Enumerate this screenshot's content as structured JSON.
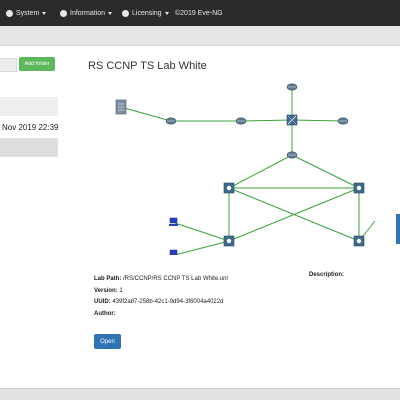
{
  "navbar": {
    "items": [
      {
        "label": "System",
        "icon": "menu-icon",
        "has_caret": true
      },
      {
        "label": "Information",
        "icon": "info-icon",
        "has_caret": true
      },
      {
        "label": "Licensing",
        "icon": "license-icon",
        "has_caret": true
      }
    ],
    "copyright": "©2019 Eve-NG"
  },
  "sidebar": {
    "add_folder_label": "Add folder",
    "date_text": "Nov 2019 22:39"
  },
  "lab": {
    "title": "RS CCNP TS Lab White",
    "path_label": "Lab Path:",
    "path_value": "/RS/CCNP/RS CCNP TS Lab White.unl",
    "version_label": "Version:",
    "version_value": "1",
    "uuid_label": "UUID:",
    "uuid_value": "439f2a87-258b-42c1-9d94-3f6004a4022d",
    "author_label": "Author:",
    "author_value": "",
    "description_label": "Description:",
    "open_label": "Open"
  },
  "colors": {
    "navbar_bg": "#2b2b2b",
    "link_color": "#3aa33a",
    "open_button": "#2f75b5",
    "add_folder_button": "#5cb85c"
  },
  "topology": {
    "node_kinds": [
      "server",
      "router",
      "switch",
      "multilayer-switch",
      "host"
    ],
    "node_count": 13,
    "link_count": 14
  }
}
